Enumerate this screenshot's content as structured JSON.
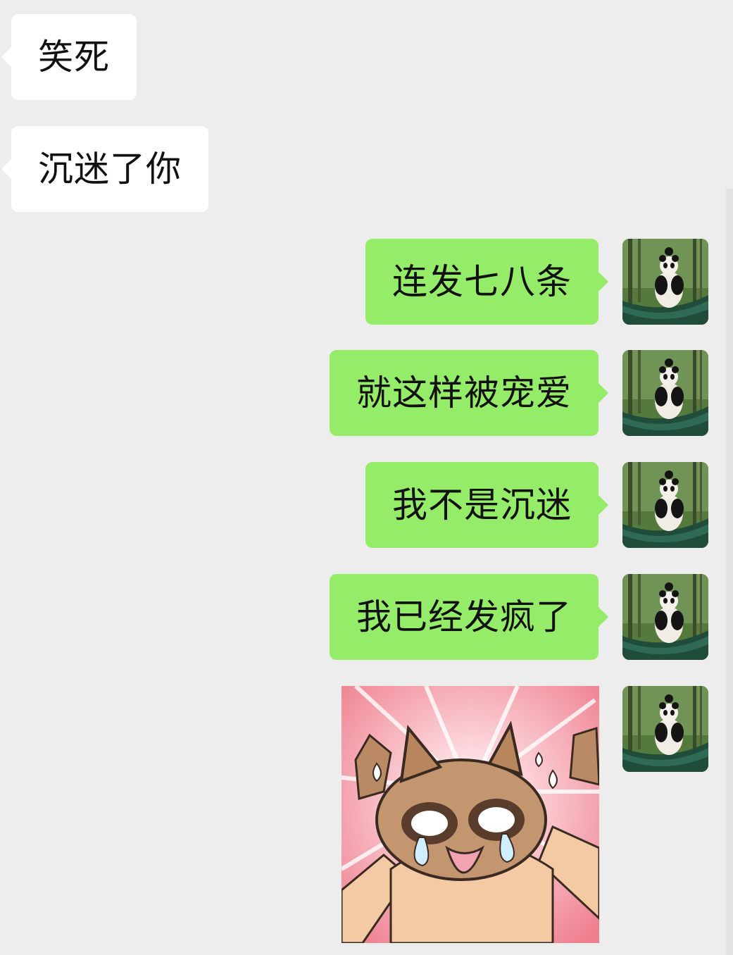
{
  "colors": {
    "background": "#ededed",
    "incoming_bubble": "#ffffff",
    "outgoing_bubble": "#95ec69",
    "text": "#111111"
  },
  "messages": [
    {
      "direction": "incoming",
      "type": "text",
      "text": "笑死"
    },
    {
      "direction": "incoming",
      "type": "text",
      "text": "沉迷了你"
    },
    {
      "direction": "outgoing",
      "type": "text",
      "text": "连发七八条"
    },
    {
      "direction": "outgoing",
      "type": "text",
      "text": "就这样被宠爱"
    },
    {
      "direction": "outgoing",
      "type": "text",
      "text": "我不是沉迷"
    },
    {
      "direction": "outgoing",
      "type": "text",
      "text": "我已经发疯了"
    },
    {
      "direction": "outgoing",
      "type": "sticker",
      "sticker": "screaming-cat-sticker"
    }
  ],
  "avatar": {
    "icon": "panda-avatar-icon"
  }
}
